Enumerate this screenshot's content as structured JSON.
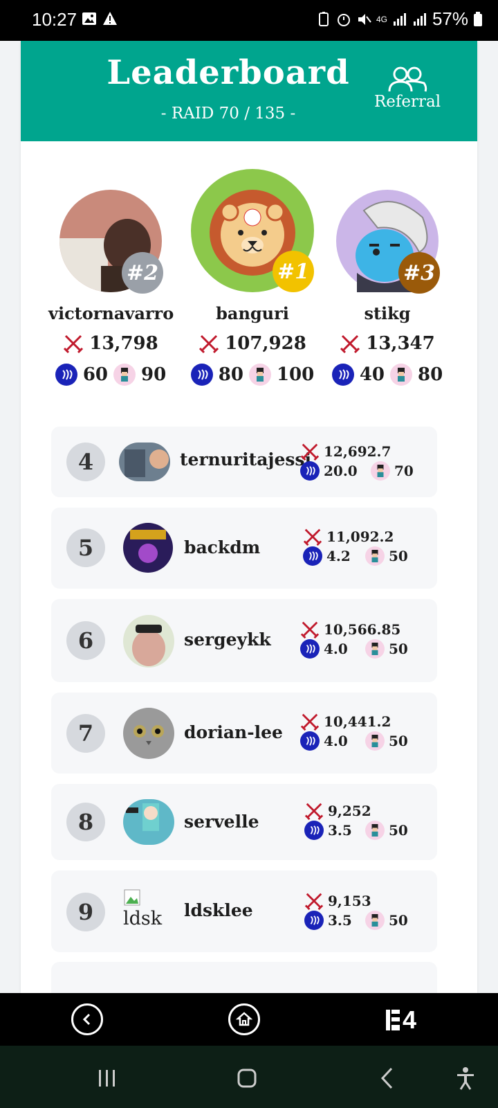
{
  "status": {
    "time": "10:27",
    "battery": "57%",
    "network": "4G"
  },
  "header": {
    "title": "Leaderboard",
    "subtitle": "- RAID 70 / 135 -",
    "referral_label": "Referral"
  },
  "podium": [
    {
      "rank_label": "#2",
      "name": "victornavarro",
      "damage": "13,798",
      "steem": "60",
      "char": "90",
      "badge_color": "#9aa0a8"
    },
    {
      "rank_label": "#1",
      "name": "banguri",
      "damage": "107,928",
      "steem": "80",
      "char": "100",
      "badge_color": "#f2c200"
    },
    {
      "rank_label": "#3",
      "name": "stikg",
      "damage": "13,347",
      "steem": "40",
      "char": "80",
      "badge_color": "#9a5a0a"
    }
  ],
  "rows": [
    {
      "rank": "4",
      "name": "ternuritajessi",
      "damage": "12,692.7",
      "steem": "20.0",
      "char": "70"
    },
    {
      "rank": "5",
      "name": "backdm",
      "damage": "11,092.2",
      "steem": "4.2",
      "char": "50"
    },
    {
      "rank": "6",
      "name": "sergeykk",
      "damage": "10,566.85",
      "steem": "4.0",
      "char": "50"
    },
    {
      "rank": "7",
      "name": "dorian-lee",
      "damage": "10,441.2",
      "steem": "4.0",
      "char": "50"
    },
    {
      "rank": "8",
      "name": "servelle",
      "damage": "9,252",
      "steem": "3.5",
      "char": "50"
    },
    {
      "rank": "9",
      "name": "ldsklee",
      "avatar_alt": "ldsk",
      "damage": "9,153",
      "steem": "3.5",
      "char": "50"
    }
  ],
  "colors": {
    "header": "#00a58e",
    "steem": "#1a23b8",
    "sword": "#c0192c"
  },
  "icons": {
    "sword": "crossed-swords-icon",
    "steem": "steem-icon",
    "char": "character-icon",
    "referral": "users-icon"
  },
  "bottom_nav": {
    "tab_count": "4"
  }
}
